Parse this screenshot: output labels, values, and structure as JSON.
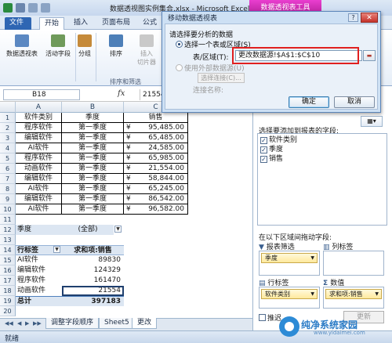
{
  "titlebar": {
    "title": "数据透视图实例集合.xlsx - Microsoft Excel",
    "context_tool": "数据透视表工具"
  },
  "ribbon": {
    "tabs": [
      "文件",
      "开始",
      "插入",
      "页面布局",
      "公式"
    ],
    "buttons": {
      "pivot_table": "数据透视表",
      "active_field": "活动字段",
      "group": "分组",
      "sort": "排序",
      "insert_slicer_1": "插入",
      "insert_slicer_2": "切片器"
    },
    "group_label": "排序和筛选"
  },
  "formula_bar": {
    "name_box": "B18",
    "fx": "fx",
    "value": "21554"
  },
  "grid": {
    "columns": [
      "A",
      "B",
      "C"
    ],
    "row_numbers": [
      "1",
      "2",
      "3",
      "4",
      "5",
      "6",
      "7",
      "8",
      "9",
      "10",
      "11",
      "12",
      "13",
      "14",
      "15",
      "16",
      "17",
      "18",
      "19",
      "20"
    ],
    "table_header": [
      "软件类别",
      "季度",
      "销售"
    ],
    "rows": [
      {
        "category": "程序软件",
        "quarter": "第一季度",
        "currency": "¥",
        "amount": "95,485.00"
      },
      {
        "category": "编辑软件",
        "quarter": "第一季度",
        "currency": "¥",
        "amount": "65,485.00"
      },
      {
        "category": "AI软件",
        "quarter": "第一季度",
        "currency": "¥",
        "amount": "24,585.00"
      },
      {
        "category": "程序软件",
        "quarter": "第一季度",
        "currency": "¥",
        "amount": "65,985.00"
      },
      {
        "category": "动画软件",
        "quarter": "第一季度",
        "currency": "¥",
        "amount": "21,554.00"
      },
      {
        "category": "编辑软件",
        "quarter": "第一季度",
        "currency": "¥",
        "amount": "58,844.00"
      },
      {
        "category": "AI软件",
        "quarter": "第一季度",
        "currency": "¥",
        "amount": "65,245.00"
      },
      {
        "category": "编辑软件",
        "quarter": "第一季度",
        "currency": "¥",
        "amount": "86,542.00"
      },
      {
        "category": "AI软件",
        "quarter": "第一季度",
        "currency": "¥",
        "amount": "96,582.00"
      }
    ],
    "pivot": {
      "filter_field": "季度",
      "filter_value": "(全部)",
      "row_label": "行标签",
      "value_label": "求和项:销售",
      "rows": [
        {
          "label": "AI软件",
          "value": "89830"
        },
        {
          "label": "编辑软件",
          "value": "124329"
        },
        {
          "label": "程序软件",
          "value": "161470"
        },
        {
          "label": "动画软件",
          "value": "21554"
        }
      ],
      "total_label": "总计",
      "total_value": "397183"
    }
  },
  "sheet_tabs": [
    "调整字段顺序",
    "Sheet5",
    "更改"
  ],
  "status": "就绪",
  "field_list": {
    "title": "选择要添加到报表的字段:",
    "fields": [
      {
        "name": "软件类别",
        "checked": true
      },
      {
        "name": "季度",
        "checked": true
      },
      {
        "name": "销售",
        "checked": true
      }
    ],
    "drag_label": "在以下区域间拖动字段:",
    "report_filter": "报表筛选",
    "column_labels": "列标签",
    "row_labels": "行标签",
    "values": "数值",
    "filter_chip": "季度",
    "row_chip": "软件类别",
    "value_chip": "求和项:销售",
    "defer_label": "推迟",
    "update_button": "更新"
  },
  "dialog": {
    "title": "移动数据透视表",
    "prompt": "请选择要分析的数据",
    "option_table": "选择一个表或区域(S)",
    "range_label": "表/区域(T):",
    "range_value": "更改数据源!$A$1:$C$10",
    "option_external": "使用外部数据源(U)",
    "choose_connection": "选择连接(C)...",
    "connection_name": "连接名称:",
    "ok": "确定",
    "cancel": "取消"
  },
  "watermark": {
    "text": "纯净系统家园",
    "url": "www.yidaimei.com"
  }
}
